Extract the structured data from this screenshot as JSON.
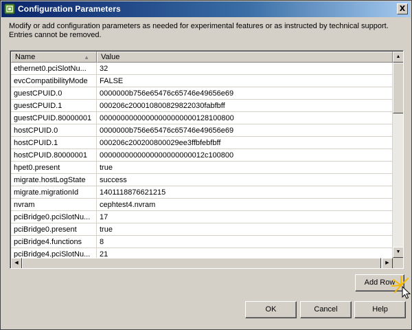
{
  "window": {
    "title": "Configuration Parameters",
    "close_glyph": "X"
  },
  "description": "Modify or add configuration parameters as needed for experimental features or as instructed by technical support. Entries cannot be removed.",
  "table": {
    "headers": {
      "name": "Name",
      "value": "Value"
    },
    "rows": [
      {
        "name": "ethernet0.pciSlotNu...",
        "value": "32"
      },
      {
        "name": "evcCompatibilityMode",
        "value": "FALSE"
      },
      {
        "name": "guestCPUID.0",
        "value": "0000000b756e65476c65746e49656e69"
      },
      {
        "name": "guestCPUID.1",
        "value": "000206c200010800829822030fabfbff"
      },
      {
        "name": "guestCPUID.80000001",
        "value": "00000000000000000000000128100800"
      },
      {
        "name": "hostCPUID.0",
        "value": "0000000b756e65476c65746e49656e69"
      },
      {
        "name": "hostCPUID.1",
        "value": "000206c200200800029ee3ffbfebfbff"
      },
      {
        "name": "hostCPUID.80000001",
        "value": "0000000000000000000000012c100800"
      },
      {
        "name": "hpet0.present",
        "value": "true"
      },
      {
        "name": "migrate.hostLogState",
        "value": "success"
      },
      {
        "name": "migrate.migrationId",
        "value": "1401118876621215"
      },
      {
        "name": "nvram",
        "value": "cephtest4.nvram"
      },
      {
        "name": "pciBridge0.pciSlotNu...",
        "value": "17"
      },
      {
        "name": "pciBridge0.present",
        "value": "true"
      },
      {
        "name": "pciBridge4.functions",
        "value": "8"
      },
      {
        "name": "pciBridge4.pciSlotNu...",
        "value": "21"
      }
    ]
  },
  "buttons": {
    "add_row": "Add Row",
    "ok": "OK",
    "cancel": "Cancel",
    "help": "Help"
  },
  "colors": {
    "titlebar_start": "#0a246a",
    "titlebar_end": "#a6caf0",
    "dialog_bg": "#d4d0c8"
  }
}
